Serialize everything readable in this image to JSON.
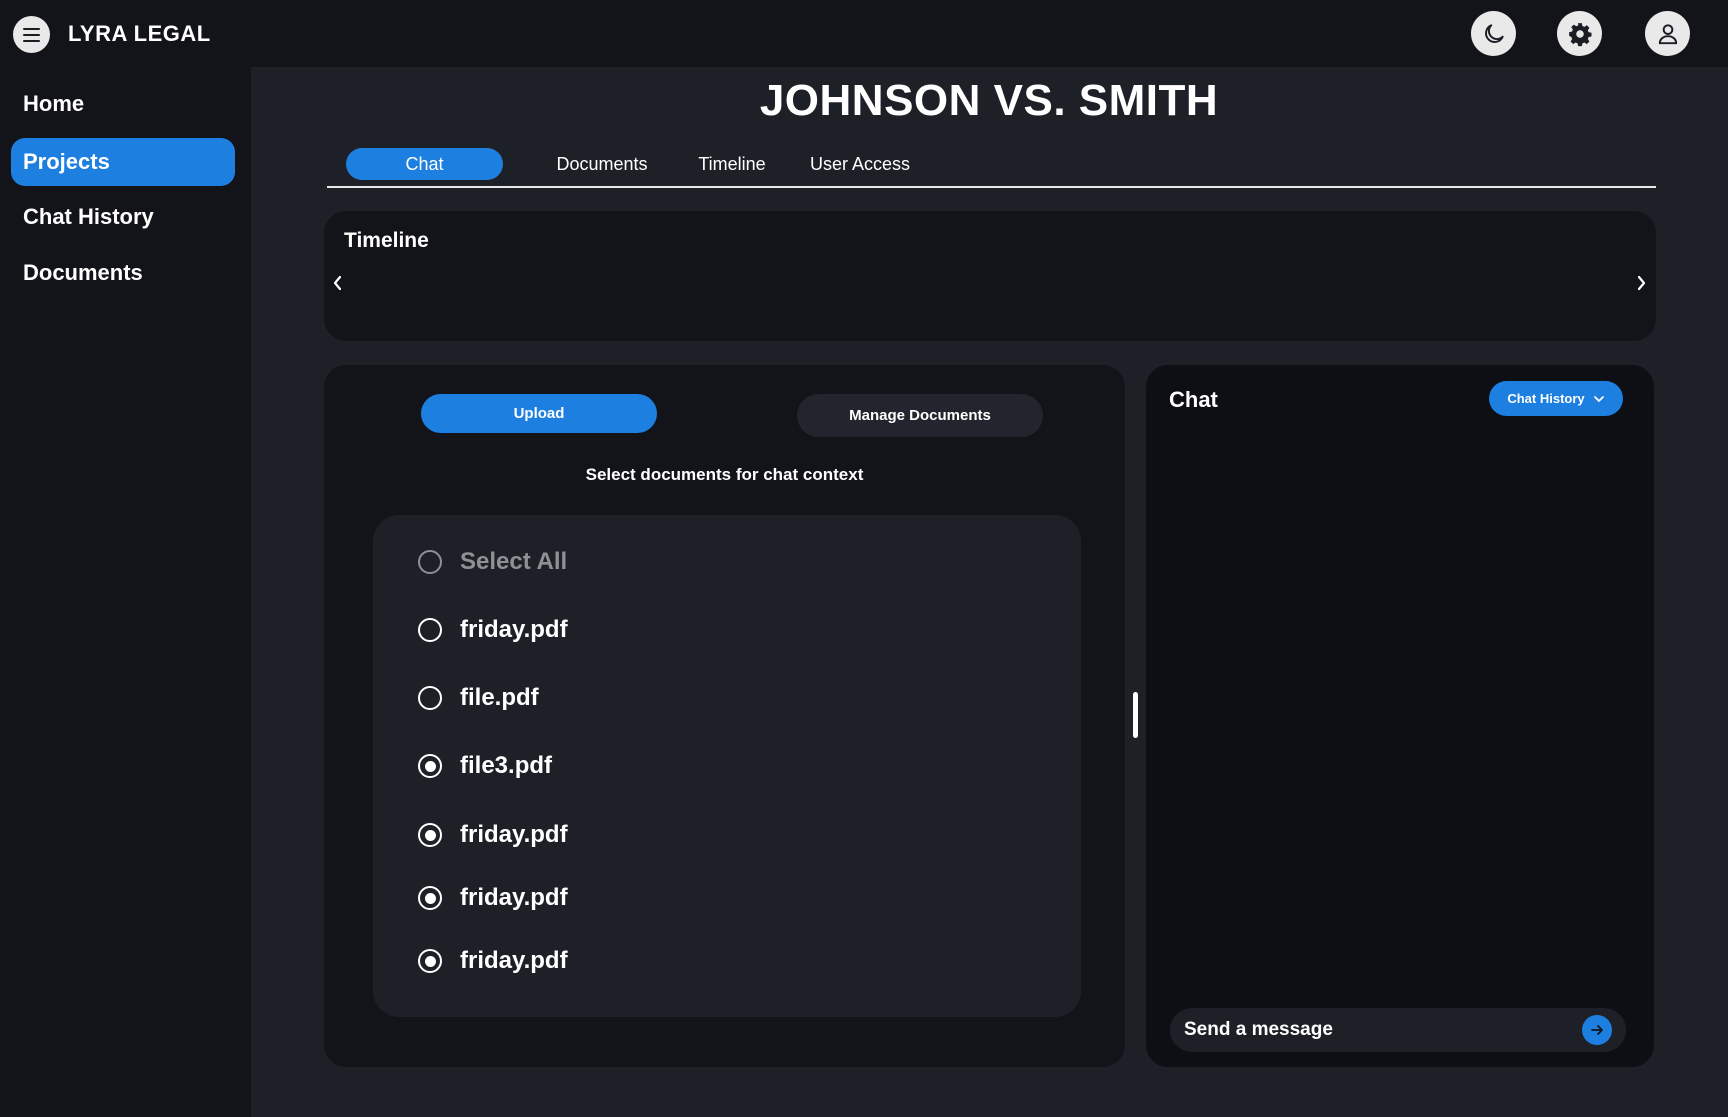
{
  "app": {
    "brand": "LYRA LEGAL"
  },
  "topbar": {
    "icons": [
      "hamburger-menu-icon",
      "moon-icon",
      "gear-icon",
      "user-icon"
    ]
  },
  "sidebar": {
    "items": [
      {
        "label": "Home",
        "active": false
      },
      {
        "label": "Projects",
        "active": true
      },
      {
        "label": "Chat History",
        "active": false
      },
      {
        "label": "Documents",
        "active": false
      }
    ]
  },
  "main": {
    "title": "JOHNSON VS. SMITH",
    "tabs": [
      {
        "label": "Chat",
        "active": true
      },
      {
        "label": "Documents",
        "active": false
      },
      {
        "label": "Timeline",
        "active": false
      },
      {
        "label": "User Access",
        "active": false
      }
    ]
  },
  "timeline": {
    "title": "Timeline",
    "prev_icon": "chevron-left-icon",
    "next_icon": "chevron-right-icon"
  },
  "documents": {
    "upload_label": "Upload",
    "manage_label": "Manage Documents",
    "hint": "Select documents for chat context",
    "select_all": {
      "label": "Select All",
      "selected": false
    },
    "files": [
      {
        "name": "friday.pdf",
        "selected": false
      },
      {
        "name": "file.pdf",
        "selected": false
      },
      {
        "name": "file3.pdf",
        "selected": true
      },
      {
        "name": "friday.pdf",
        "selected": true
      },
      {
        "name": "friday.pdf",
        "selected": true
      },
      {
        "name": "friday.pdf",
        "selected": true
      }
    ]
  },
  "chat": {
    "title": "Chat",
    "history_label": "Chat History",
    "input_placeholder": "Send a message",
    "input_value": ""
  },
  "colors": {
    "accent": "#1d7fe0",
    "page_bg": "#1e2027",
    "panel_bg": "#12141a",
    "chat_bg": "#0d0f14"
  }
}
